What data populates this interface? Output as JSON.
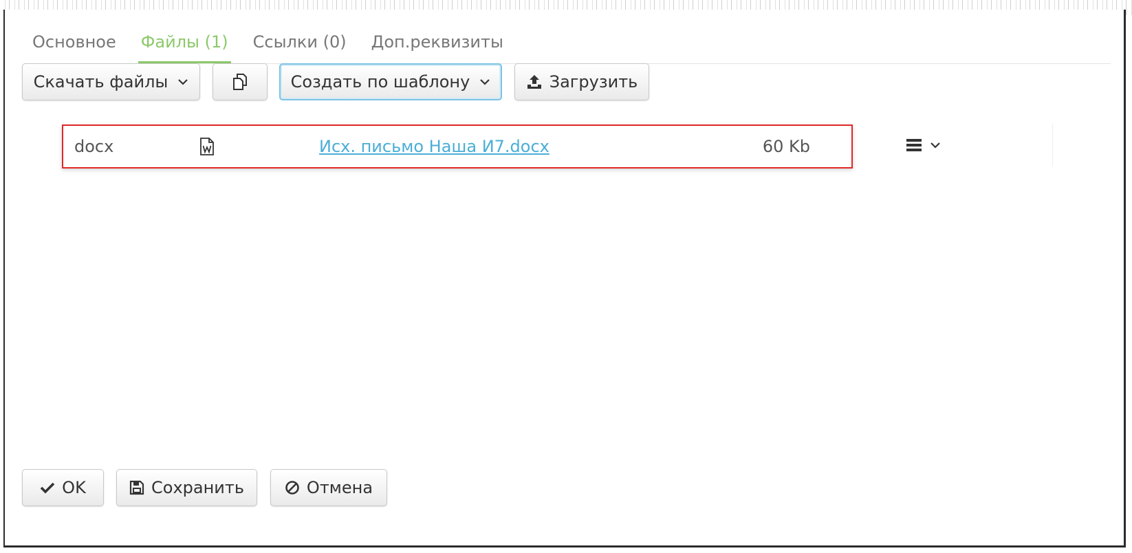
{
  "tabs": [
    {
      "label": "Основное",
      "active": false
    },
    {
      "label": "Файлы (1)",
      "active": true
    },
    {
      "label": "Ссылки (0)",
      "active": false
    },
    {
      "label": "Доп.реквизиты",
      "active": false
    }
  ],
  "toolbar": {
    "download_label": "Скачать файлы",
    "copy_icon": "copy-icon",
    "create_template_label": "Создать по шаблону",
    "upload_label": "Загрузить"
  },
  "file": {
    "extension": "docx",
    "type_icon": "word-document-icon",
    "name": "Исх. письмо  Наша  И7.docx",
    "size": "60 Kb"
  },
  "row_actions": {
    "menu_icon": "hamburger-icon",
    "chevron_icon": "chevron-down-icon"
  },
  "footer": {
    "ok_label": "OK",
    "save_label": "Сохранить",
    "cancel_label": "Отмена"
  },
  "colors": {
    "active_tab": "#8cc96b",
    "link": "#4aaed6",
    "highlight_border": "#e02727",
    "focus_border": "#7cc3e3"
  }
}
